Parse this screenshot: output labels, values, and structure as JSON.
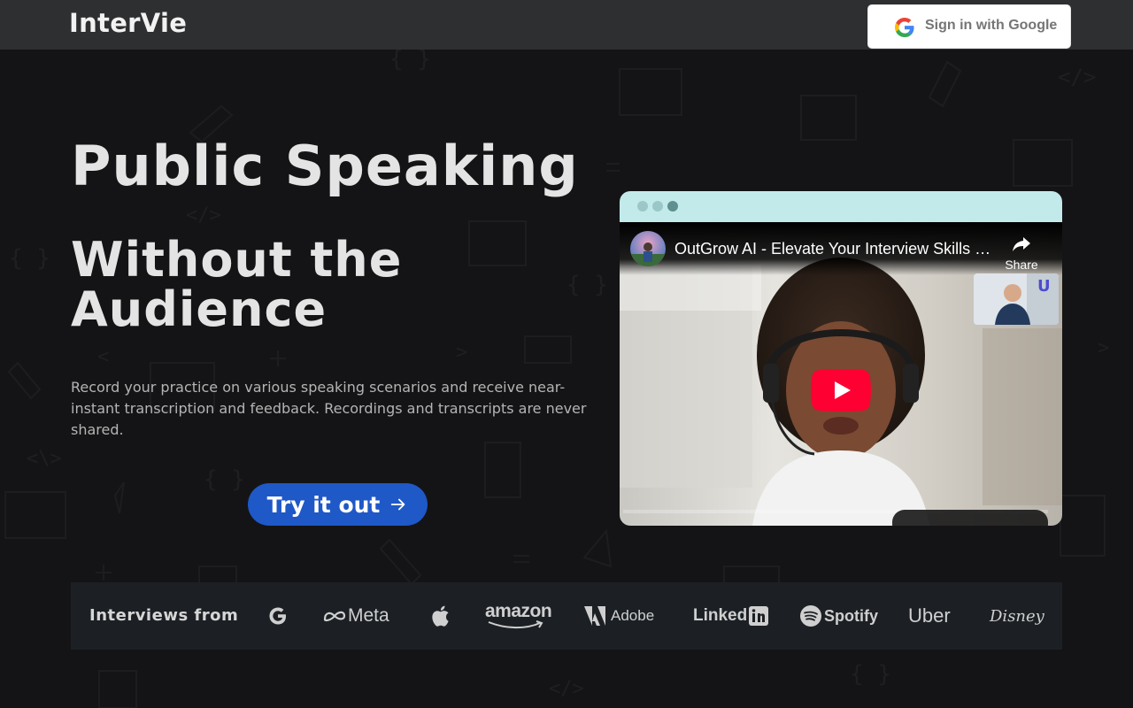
{
  "header": {
    "logo": "InterVie",
    "sign_in_label": "Sign in with Google"
  },
  "hero": {
    "title": "Public Speaking",
    "subtitle": "Without the Audience",
    "description": "Record your practice on various speaking scenarios and receive near-instant transcription and feedback. Recordings and transcripts are never shared.",
    "cta_label": "Try it out"
  },
  "video": {
    "title": "OutGrow AI - Elevate Your Interview Skills with AI",
    "share_label": "Share"
  },
  "logos": {
    "label": "Interviews from",
    "brands": [
      {
        "name": "Google",
        "text": ""
      },
      {
        "name": "Meta",
        "text": "Meta"
      },
      {
        "name": "Apple",
        "text": ""
      },
      {
        "name": "Amazon",
        "text": "amazon"
      },
      {
        "name": "Adobe",
        "text": "Adobe"
      },
      {
        "name": "LinkedIn",
        "text": "Linked"
      },
      {
        "name": "Spotify",
        "text": "Spotify"
      },
      {
        "name": "Uber",
        "text": "Uber"
      },
      {
        "name": "Disney",
        "text": "Disney"
      }
    ]
  },
  "colors": {
    "background": "#141416",
    "header": "#2e2f31",
    "cta": "#1f58c7",
    "window_bar": "#c3eaea",
    "logos_band": "#1c2024",
    "youtube_red": "#ff0033"
  }
}
